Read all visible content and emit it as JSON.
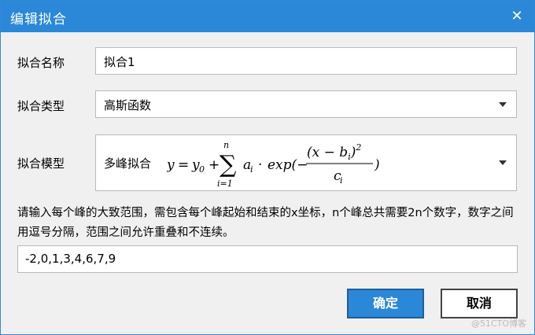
{
  "window": {
    "title": "编辑拟合",
    "close_glyph": "✕"
  },
  "fit_name": {
    "label": "拟合名称",
    "value": "拟合1"
  },
  "fit_type": {
    "label": "拟合类型",
    "value": "高斯函数"
  },
  "fit_model": {
    "label": "拟合模型",
    "value": "多峰拟合"
  },
  "hint": "请输入每个峰的大致范围，需包含每个峰起始和结束的x坐标，n个峰总共需要2n个数字，数字之间用逗号分隔，范围之间允许重叠和不连续。",
  "ranges_input": {
    "value": "-2,0,1,3,4,6,7,9"
  },
  "buttons": {
    "ok": "确定",
    "cancel": "取消"
  },
  "watermark": "@51CTO博客",
  "colors": {
    "accent": "#2b88d8",
    "background": "#f0f0f0",
    "field_border": "#b9b9b9"
  }
}
